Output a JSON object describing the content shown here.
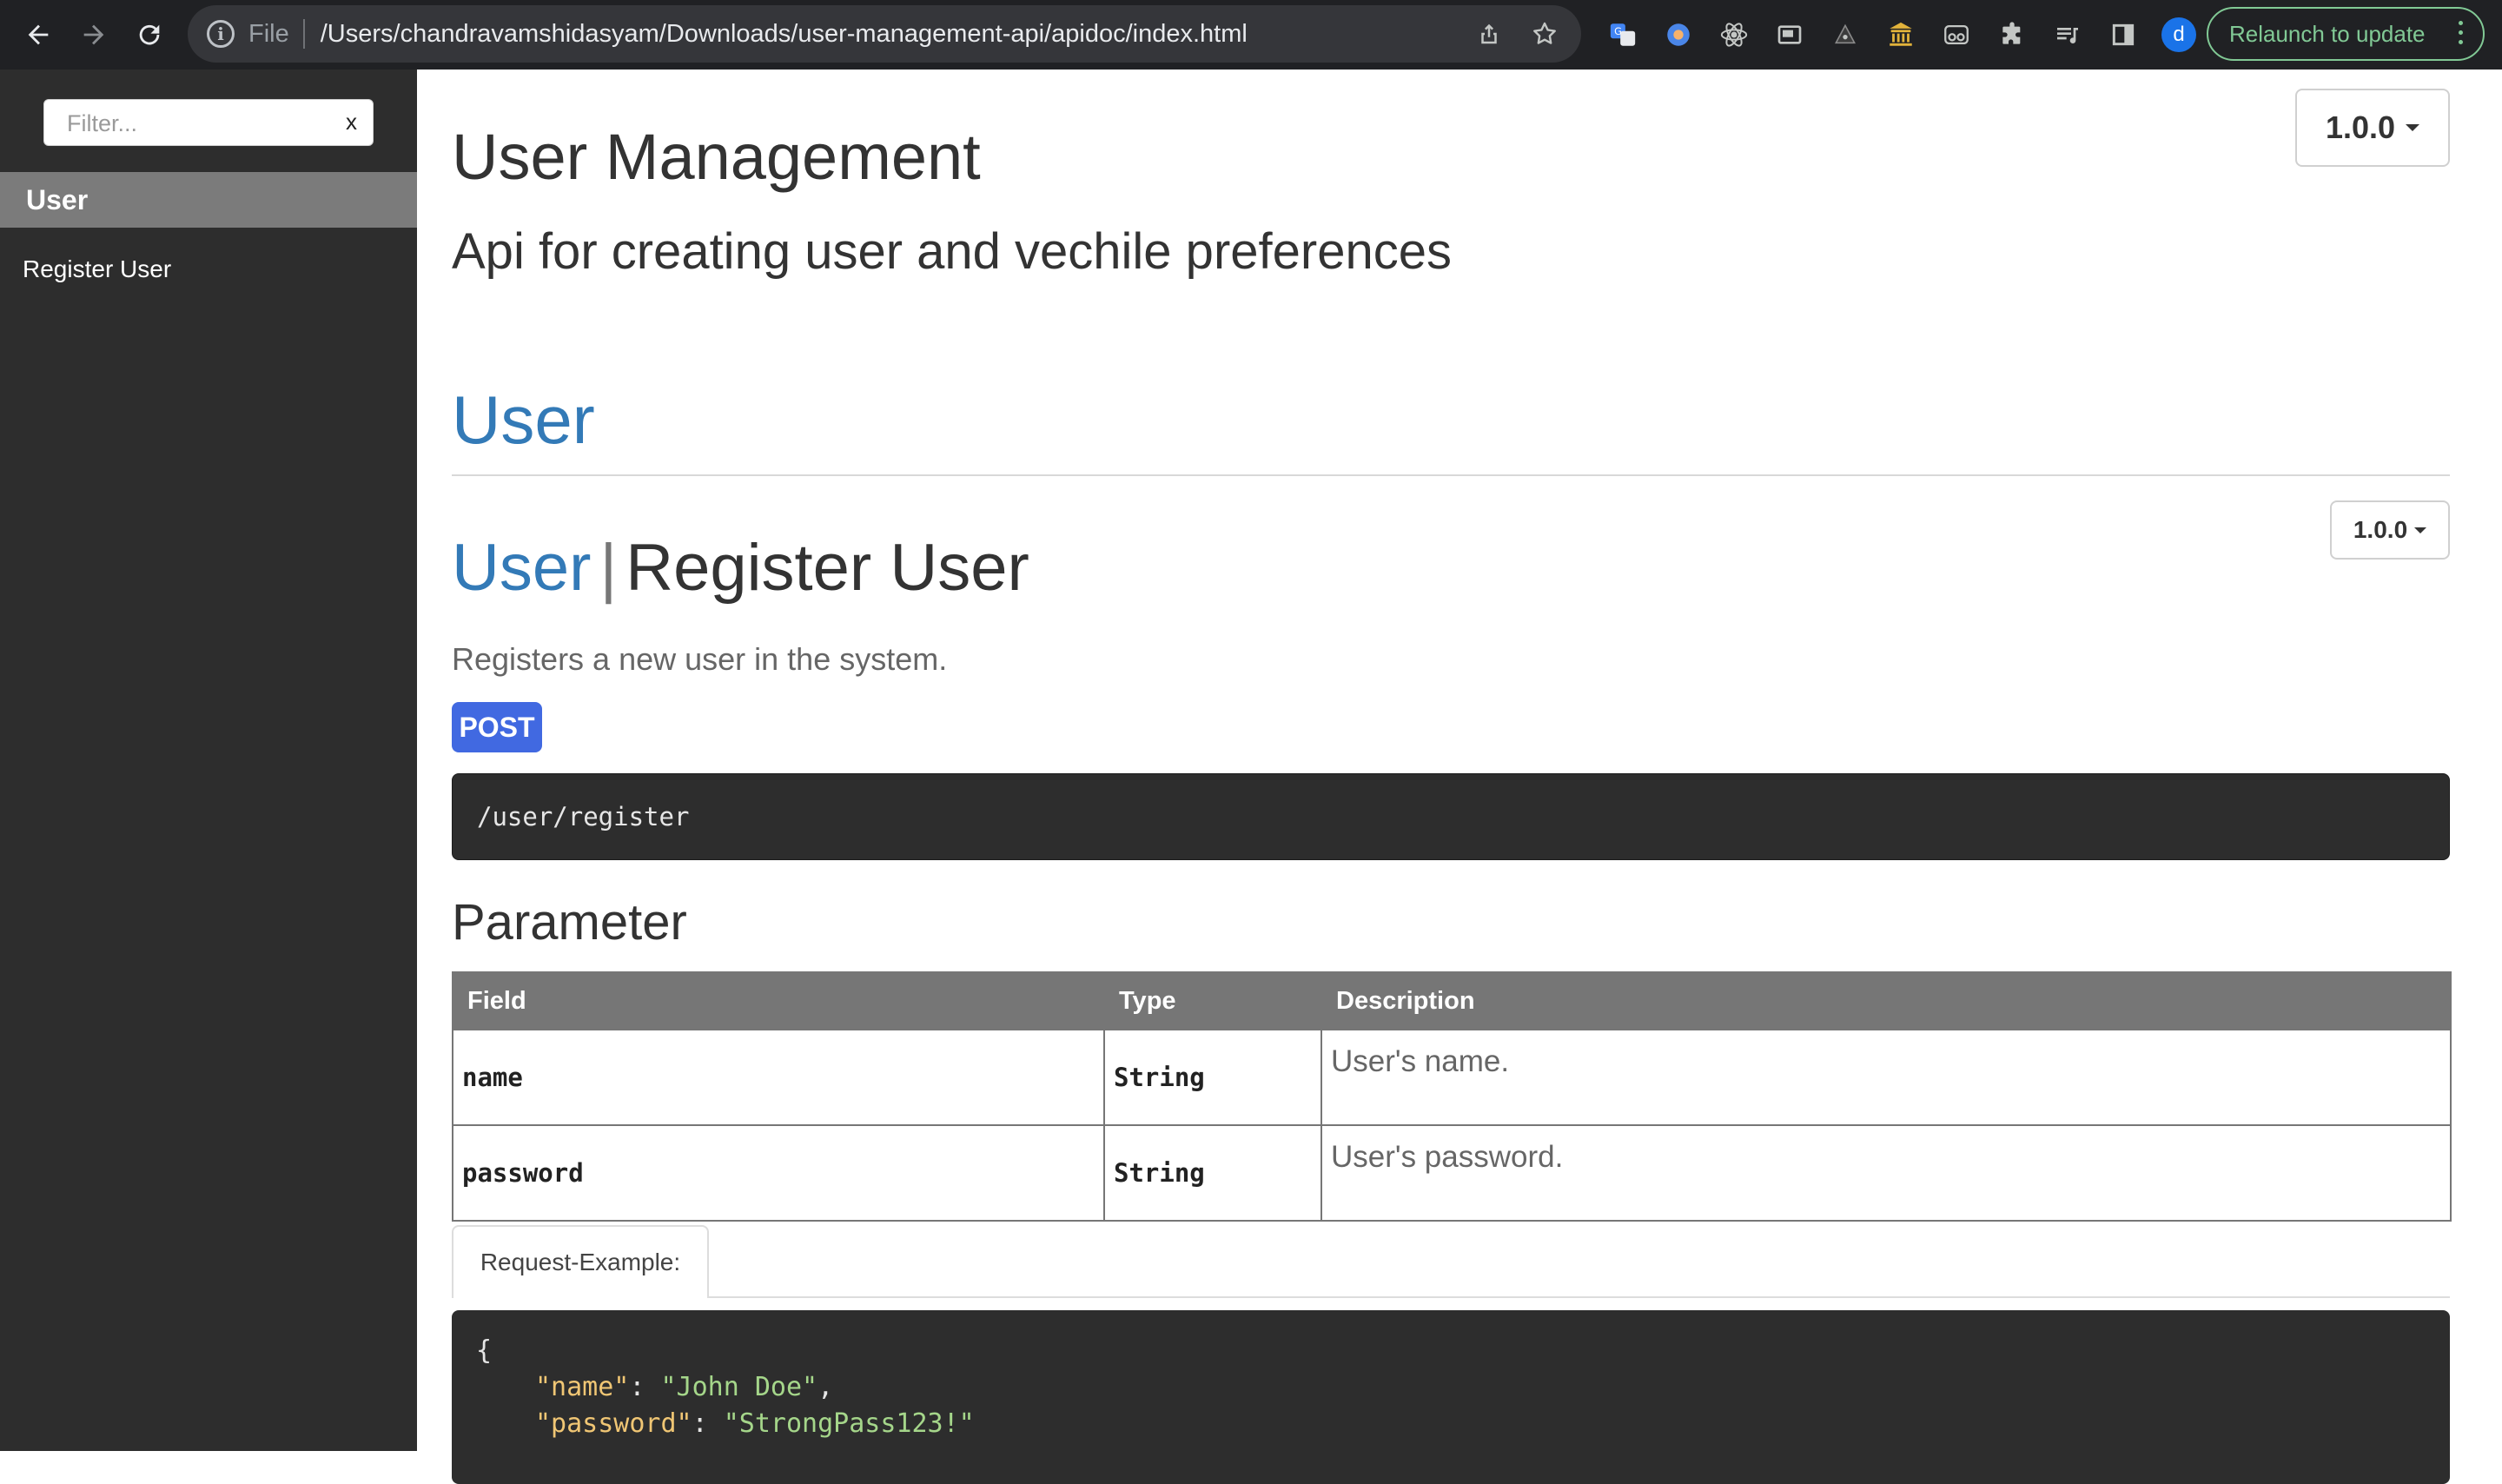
{
  "browser": {
    "scheme_label": "File",
    "url": "/Users/chandravamshidasyam/Downloads/user-management-api/apidoc/index.html",
    "profile_initial": "d",
    "relaunch_label": "Relaunch to update"
  },
  "sidebar": {
    "filter_placeholder": "Filter...",
    "filter_clear": "x",
    "group_label": "User",
    "items": [
      {
        "label": "Register User"
      }
    ]
  },
  "main": {
    "version": "1.0.0",
    "title": "User Management",
    "subtitle": "Api for creating user and vechile preferences",
    "group_title": "User",
    "endpoint": {
      "group": "User",
      "separator": "|",
      "name": "Register User",
      "version": "1.0.0",
      "description": "Registers a new user in the system.",
      "method": "POST",
      "url": "/user/register",
      "parameter_title": "Parameter",
      "table": {
        "headers": [
          "Field",
          "Type",
          "Description"
        ],
        "rows": [
          {
            "field": "name",
            "type": "String",
            "description": "User's name."
          },
          {
            "field": "password",
            "type": "String",
            "description": "User's password."
          }
        ]
      },
      "example_tab": "Request-Example:",
      "example": {
        "open_brace": "{",
        "lines": [
          {
            "key": "\"name\"",
            "value": "\"John Doe\"",
            "trail": ","
          },
          {
            "key": "\"password\"",
            "value": "\"StrongPass123!\"",
            "trail": ""
          }
        ]
      }
    }
  },
  "colors": {
    "accent_link": "#337ab7",
    "method_post": "#4169e1",
    "sidebar_bg": "#2d2d2d",
    "relaunch_green": "#81c995"
  }
}
